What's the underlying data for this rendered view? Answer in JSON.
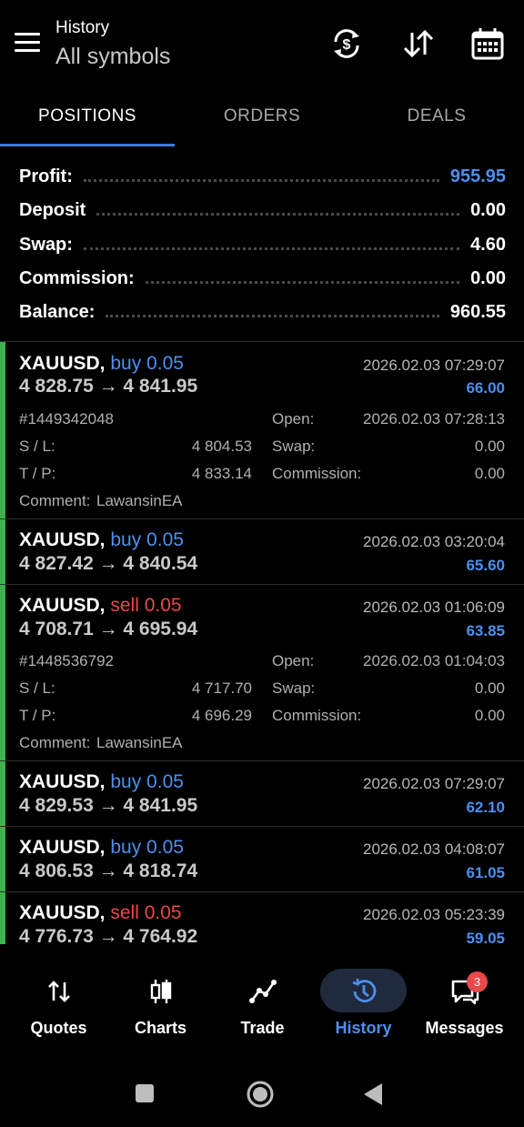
{
  "header": {
    "title": "History",
    "subtitle": "All symbols"
  },
  "tabs": [
    {
      "label": "POSITIONS",
      "active": true
    },
    {
      "label": "ORDERS",
      "active": false
    },
    {
      "label": "DEALS",
      "active": false
    }
  ],
  "summary": {
    "profit_label": "Profit:",
    "profit_value": "955.95",
    "deposit_label": "Deposit",
    "deposit_value": "0.00",
    "swap_label": "Swap:",
    "swap_value": "4.60",
    "commission_label": "Commission:",
    "commission_value": "0.00",
    "balance_label": "Balance:",
    "balance_value": "960.55"
  },
  "positions": [
    {
      "symbol": "XAUUSD,",
      "side": "buy 0.05",
      "side_type": "buy",
      "prices": "4 828.75 → 4 841.95",
      "close_time": "2026.02.03 07:29:07",
      "profit": "66.00",
      "expanded": true,
      "ticket": "#1449342048",
      "open_label": "Open:",
      "open_time": "2026.02.03 07:28:13",
      "sl_label": "S / L:",
      "sl": "4 804.53",
      "swap_label": "Swap:",
      "swap": "0.00",
      "tp_label": "T / P:",
      "tp": "4 833.14",
      "commission_label": "Commission:",
      "commission": "0.00",
      "comment_label": "Comment:",
      "comment": "LawansinEA"
    },
    {
      "symbol": "XAUUSD,",
      "side": "buy 0.05",
      "side_type": "buy",
      "prices": "4 827.42 → 4 840.54",
      "close_time": "2026.02.03 03:20:04",
      "profit": "65.60",
      "expanded": false
    },
    {
      "symbol": "XAUUSD,",
      "side": "sell 0.05",
      "side_type": "sell",
      "prices": "4 708.71 → 4 695.94",
      "close_time": "2026.02.03 01:06:09",
      "profit": "63.85",
      "expanded": true,
      "ticket": "#1448536792",
      "open_label": "Open:",
      "open_time": "2026.02.03 01:04:03",
      "sl_label": "S / L:",
      "sl": "4 717.70",
      "swap_label": "Swap:",
      "swap": "0.00",
      "tp_label": "T / P:",
      "tp": "4 696.29",
      "commission_label": "Commission:",
      "commission": "0.00",
      "comment_label": "Comment:",
      "comment": "LawansinEA"
    },
    {
      "symbol": "XAUUSD,",
      "side": "buy 0.05",
      "side_type": "buy",
      "prices": "4 829.53 → 4 841.95",
      "close_time": "2026.02.03 07:29:07",
      "profit": "62.10",
      "expanded": false
    },
    {
      "symbol": "XAUUSD,",
      "side": "buy 0.05",
      "side_type": "buy",
      "prices": "4 806.53 → 4 818.74",
      "close_time": "2026.02.03 04:08:07",
      "profit": "61.05",
      "expanded": false
    },
    {
      "symbol": "XAUUSD,",
      "side": "sell 0.05",
      "side_type": "sell",
      "prices": "4 776.73 → 4 764.92",
      "close_time": "2026.02.03 05:23:39",
      "profit": "59.05",
      "expanded": false
    }
  ],
  "bottom_nav": [
    {
      "label": "Quotes",
      "icon": "quotes-icon",
      "active": false
    },
    {
      "label": "Charts",
      "icon": "charts-icon",
      "active": false
    },
    {
      "label": "Trade",
      "icon": "trade-icon",
      "active": false
    },
    {
      "label": "History",
      "icon": "history-icon",
      "active": true
    },
    {
      "label": "Messages",
      "icon": "messages-icon",
      "active": false,
      "badge": "3"
    }
  ],
  "colors": {
    "accent_blue": "#4d8ff0",
    "sell_red": "#e8484a",
    "green_bar": "#3cb44b",
    "tab_underline": "#3d7bd9"
  }
}
